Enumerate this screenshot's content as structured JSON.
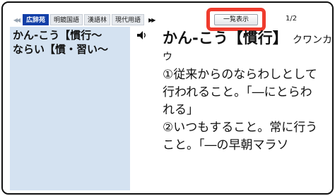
{
  "toolbar": {
    "prev_arrow": "◀◀",
    "tabs": [
      {
        "label": "広辞苑",
        "active": true
      },
      {
        "label": "明鏡国語",
        "active": false
      },
      {
        "label": "漢語林",
        "active": false
      },
      {
        "label": "現代用語",
        "active": false
      }
    ],
    "next_arrow": "▶▶",
    "list_button": "一覧表示",
    "page": "1/2"
  },
  "sidebar": {
    "items": [
      {
        "label": "かん‐こう【慣行〜"
      },
      {
        "label": "ならい【慣・習い〜"
      }
    ]
  },
  "entry": {
    "speaker_icon": "speaker-icon",
    "headword": "かん‐こう【慣行】",
    "reading": "クワンカ",
    "reading_cont": "ウ",
    "definitions": [
      "①従来からのならわしとして行われること。「―にとらわれる」",
      "②いつもすること。常に行うこと。「―の早朝マラソ"
    ]
  },
  "colors": {
    "active_tab": "#123fa8",
    "sidebar_bg": "#d4e2f1",
    "highlight": "#ef3b2d"
  }
}
